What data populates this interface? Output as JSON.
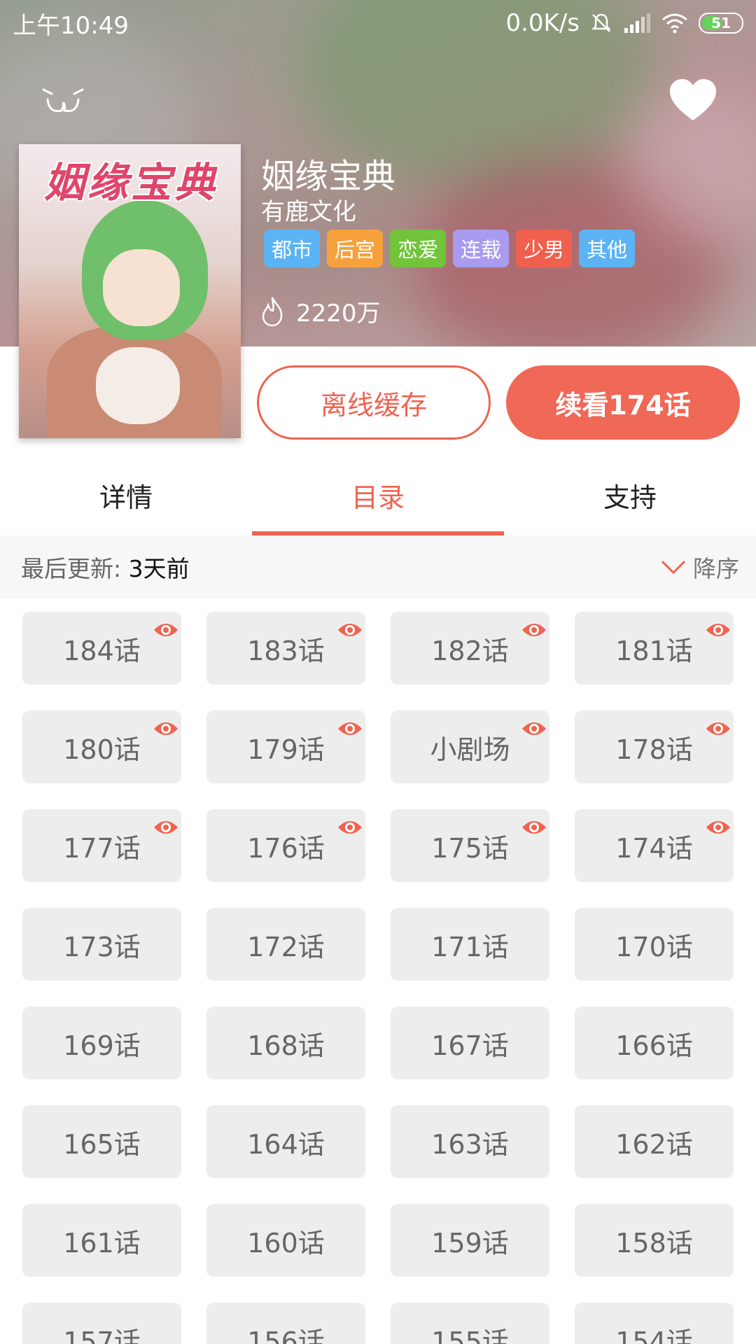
{
  "status_bar": {
    "time": "上午10:49",
    "network_speed": "0.0K/s",
    "battery": "51"
  },
  "book": {
    "cover_title": "姻缘宝典",
    "title": "姻缘宝典",
    "author": "有鹿文化",
    "tags": [
      {
        "label": "都市",
        "color": "#5cb3f3"
      },
      {
        "label": "后宫",
        "color": "#f7a13d"
      },
      {
        "label": "恋爱",
        "color": "#72c43b"
      },
      {
        "label": "连载",
        "color": "#a99bf0"
      },
      {
        "label": "少男",
        "color": "#f0604f"
      },
      {
        "label": "其他",
        "color": "#5cb3f3"
      }
    ],
    "popularity": "2220万"
  },
  "actions": {
    "offline_cache": "离线缓存",
    "continue_reading": "续看174话"
  },
  "tabs": [
    {
      "label": "详情",
      "active": false
    },
    {
      "label": "目录",
      "active": true
    },
    {
      "label": "支持",
      "active": false
    }
  ],
  "update": {
    "label": "最后更新:",
    "value": "3天前",
    "sort": "降序"
  },
  "colors": {
    "accent": "#ef6451",
    "chip_bg": "#ededed"
  },
  "chapters": [
    {
      "label": "184话",
      "read": true
    },
    {
      "label": "183话",
      "read": true
    },
    {
      "label": "182话",
      "read": true
    },
    {
      "label": "181话",
      "read": true
    },
    {
      "label": "180话",
      "read": true
    },
    {
      "label": "179话",
      "read": true
    },
    {
      "label": "小剧场",
      "read": true
    },
    {
      "label": "178话",
      "read": true
    },
    {
      "label": "177话",
      "read": true
    },
    {
      "label": "176话",
      "read": true
    },
    {
      "label": "175话",
      "read": true
    },
    {
      "label": "174话",
      "read": true
    },
    {
      "label": "173话",
      "read": false
    },
    {
      "label": "172话",
      "read": false
    },
    {
      "label": "171话",
      "read": false
    },
    {
      "label": "170话",
      "read": false
    },
    {
      "label": "169话",
      "read": false
    },
    {
      "label": "168话",
      "read": false
    },
    {
      "label": "167话",
      "read": false
    },
    {
      "label": "166话",
      "read": false
    },
    {
      "label": "165话",
      "read": false
    },
    {
      "label": "164话",
      "read": false
    },
    {
      "label": "163话",
      "read": false
    },
    {
      "label": "162话",
      "read": false
    },
    {
      "label": "161话",
      "read": false
    },
    {
      "label": "160话",
      "read": false
    },
    {
      "label": "159话",
      "read": false
    },
    {
      "label": "158话",
      "read": false
    },
    {
      "label": "157话",
      "read": false
    },
    {
      "label": "156话",
      "read": false
    },
    {
      "label": "155话",
      "read": false
    },
    {
      "label": "154话",
      "read": false
    }
  ]
}
